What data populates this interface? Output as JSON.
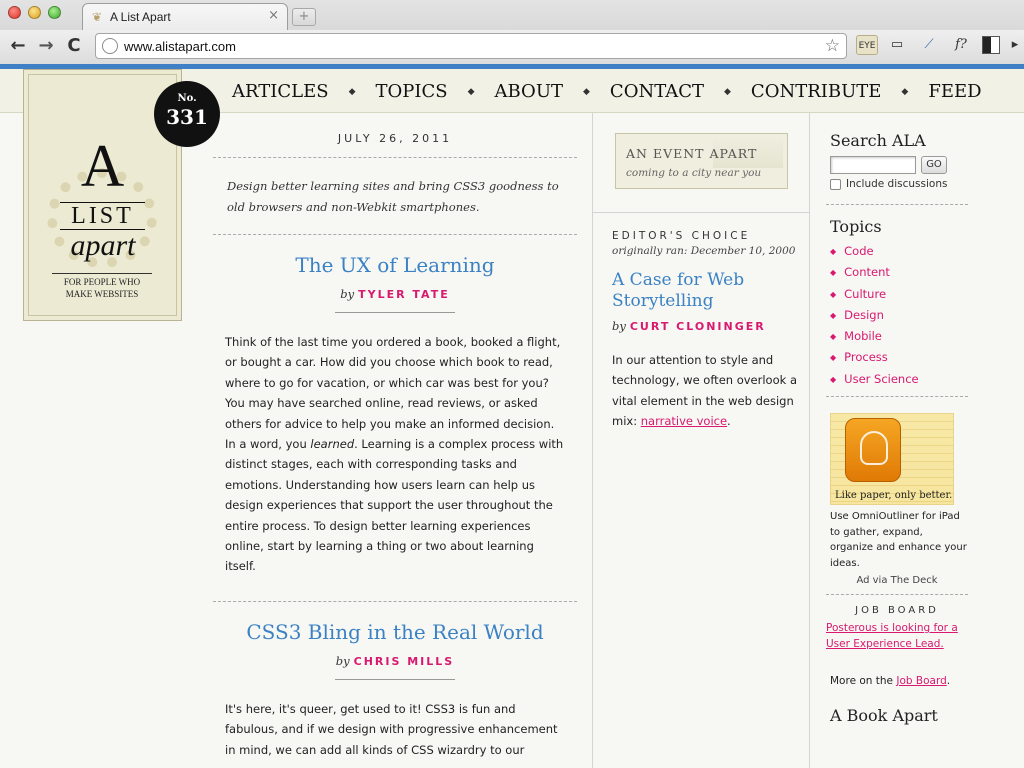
{
  "browser": {
    "tab_title": "A List Apart",
    "tab_close": "×",
    "new_tab": "+",
    "url": "www.alistapart.com",
    "back": "←",
    "forward": "→",
    "reload": "C",
    "bookmark_star": "☆",
    "ext_eye": "EYE",
    "ext_f": "f?"
  },
  "nav": {
    "items": [
      "ARTICLES",
      "TOPICS",
      "ABOUT",
      "CONTACT",
      "CONTRIBUTE",
      "FEED"
    ],
    "separator": "◆"
  },
  "logo": {
    "letter": "A",
    "list": "LIST",
    "apart": "apart",
    "tagline": "FOR PEOPLE WHO MAKE WEBSITES"
  },
  "issue": {
    "label": "No.",
    "number": "331"
  },
  "main": {
    "date": "JULY 26, 2011",
    "intro": "Design better learning sites and bring CSS3 goodness to old browsers and non-Webkit smartphones.",
    "articles": [
      {
        "title": "The UX of Learning",
        "by": "by",
        "author": "TYLER TATE",
        "body_before": "Think of the last time you ordered a book, booked a flight, or bought a car. How did you choose which book to read, where to go for vacation, or which car was best for you? You may have searched online, read reviews, or asked others for advice to help you make an informed decision. In a word, you ",
        "body_em": "learned",
        "body_after": ". Learning is a complex process with distinct stages, each with corresponding tasks and emotions. Understanding how users learn can help us design experiences that support the user throughout the entire process. To design better learning experiences online, start by learning a thing or two about learning itself."
      },
      {
        "title": "CSS3 Bling in the Real World",
        "by": "by",
        "author": "CHRIS MILLS",
        "body": "It's here, it's queer, get used to it! CSS3 is fun and fabulous, and if we design with progressive enhancement in mind, we can add all kinds of CSS wizardry to our"
      }
    ]
  },
  "middle": {
    "aea_title": "AN EVENT APART",
    "aea_subtitle": "coming to a city near you",
    "ec_label": "EDITOR'S CHOICE",
    "ec_orig": "originally ran: December 10, 2000",
    "ec_title": "A Case for Web Storytelling",
    "ec_by": "by",
    "ec_author": "CURT CLONINGER",
    "ec_body": "In our attention to style and technology, we often overlook a vital element in the web design mix: ",
    "ec_link": "narrative voice",
    "ec_end": "."
  },
  "right": {
    "search_title": "Search ALA",
    "go_label": "GO",
    "include_label": "Include discussions",
    "topics_title": "Topics",
    "topics": [
      "Code",
      "Content",
      "Culture",
      "Design",
      "Mobile",
      "Process",
      "User Science"
    ],
    "ad_caption": "Like paper, only better.",
    "ad_text": "Use OmniOutliner for iPad to gather, expand, organize and enhance your ideas.",
    "ad_via": "Ad via The Deck",
    "jobboard_label": "JOB BOARD",
    "jobboard_link": "Posterous is looking for a User Experience Lead.",
    "more_prefix": "More on the ",
    "more_link": "Job Board",
    "more_suffix": ".",
    "book_title": "A Book Apart"
  },
  "colors": {
    "link_blue": "#3b82c4",
    "accent_pink": "#d8196f",
    "browser_blue_bar": "#3f7fc5"
  }
}
